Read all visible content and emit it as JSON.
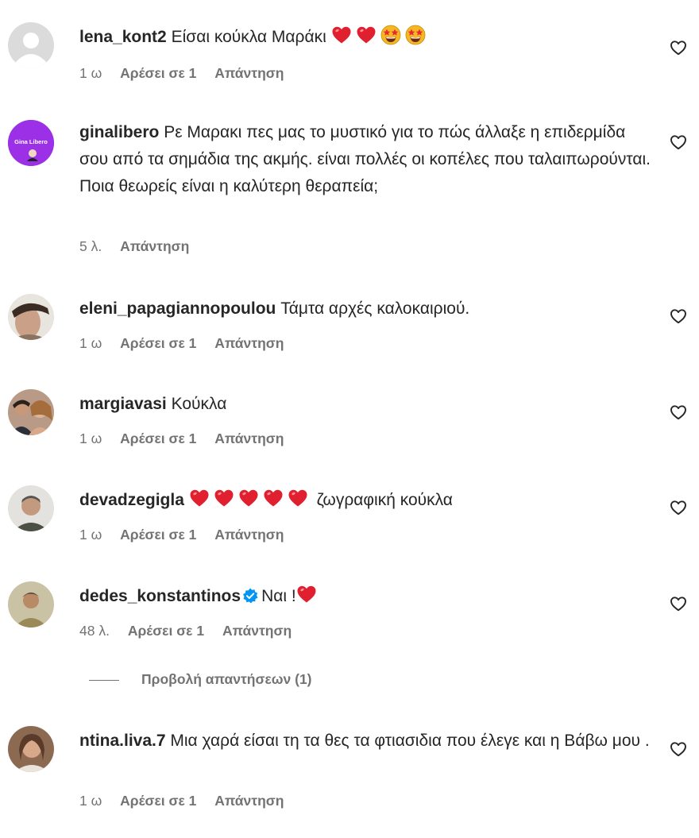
{
  "comments": [
    {
      "username": "lena_kont2",
      "text": "Είσαι κούκλα Μαράκι",
      "time": "1 ω",
      "likes": "Αρέσει σε 1",
      "reply": "Απάντηση",
      "avatar": "default-avatar"
    },
    {
      "username": "ginalibero",
      "text": "Ρε Μαρακι πες μας το μυστικό για το πώς άλλαξε η επιδερμίδα σου από τα σημάδια της ακμής. είναι πολλές οι κοπέλες που ταλαιπωρούνται. Ποια θεωρείς είναι η καλύτερη θεραπεία;",
      "time": "5 λ.",
      "reply": "Απάντηση",
      "avatar_text": "Gina Libero"
    },
    {
      "username": "eleni_papagiannopoulou",
      "text": "Τάμτα αρχές καλοκαιριού.",
      "time": "1 ω",
      "likes": "Αρέσει σε 1",
      "reply": "Απάντηση"
    },
    {
      "username": "margiavasi",
      "text": "Κούκλα",
      "time": "1 ω",
      "likes": "Αρέσει σε 1",
      "reply": "Απάντηση"
    },
    {
      "username": "devadzegigla",
      "text": "ζωγραφική κούκλα",
      "time": "1 ω",
      "likes": "Αρέσει σε 1",
      "reply": "Απάντηση"
    },
    {
      "username": "dedes_konstantinos",
      "text": "Ναι !",
      "time": "48 λ.",
      "likes": "Αρέσει σε 1",
      "reply": "Απάντηση",
      "verified": true
    },
    {
      "username": "ntina.liva.7",
      "text": "Μια χαρά είσαι τη τα θες τα φτιασιδια που έλεγε και η Βάβω μου .",
      "time": "1 ω",
      "likes": "Αρέσει σε 1",
      "reply": "Απάντηση"
    }
  ],
  "view_replies": "Προβολή απαντήσεων (1)",
  "icons": {
    "like": "heart-outline-icon",
    "heart": "red-heart-emoji",
    "star_eyes": "star-struck-emoji",
    "verified": "verified-badge-icon"
  },
  "colors": {
    "text": "#262626",
    "meta": "#737373",
    "heart": "#e0202f",
    "verified": "#0095f6"
  }
}
